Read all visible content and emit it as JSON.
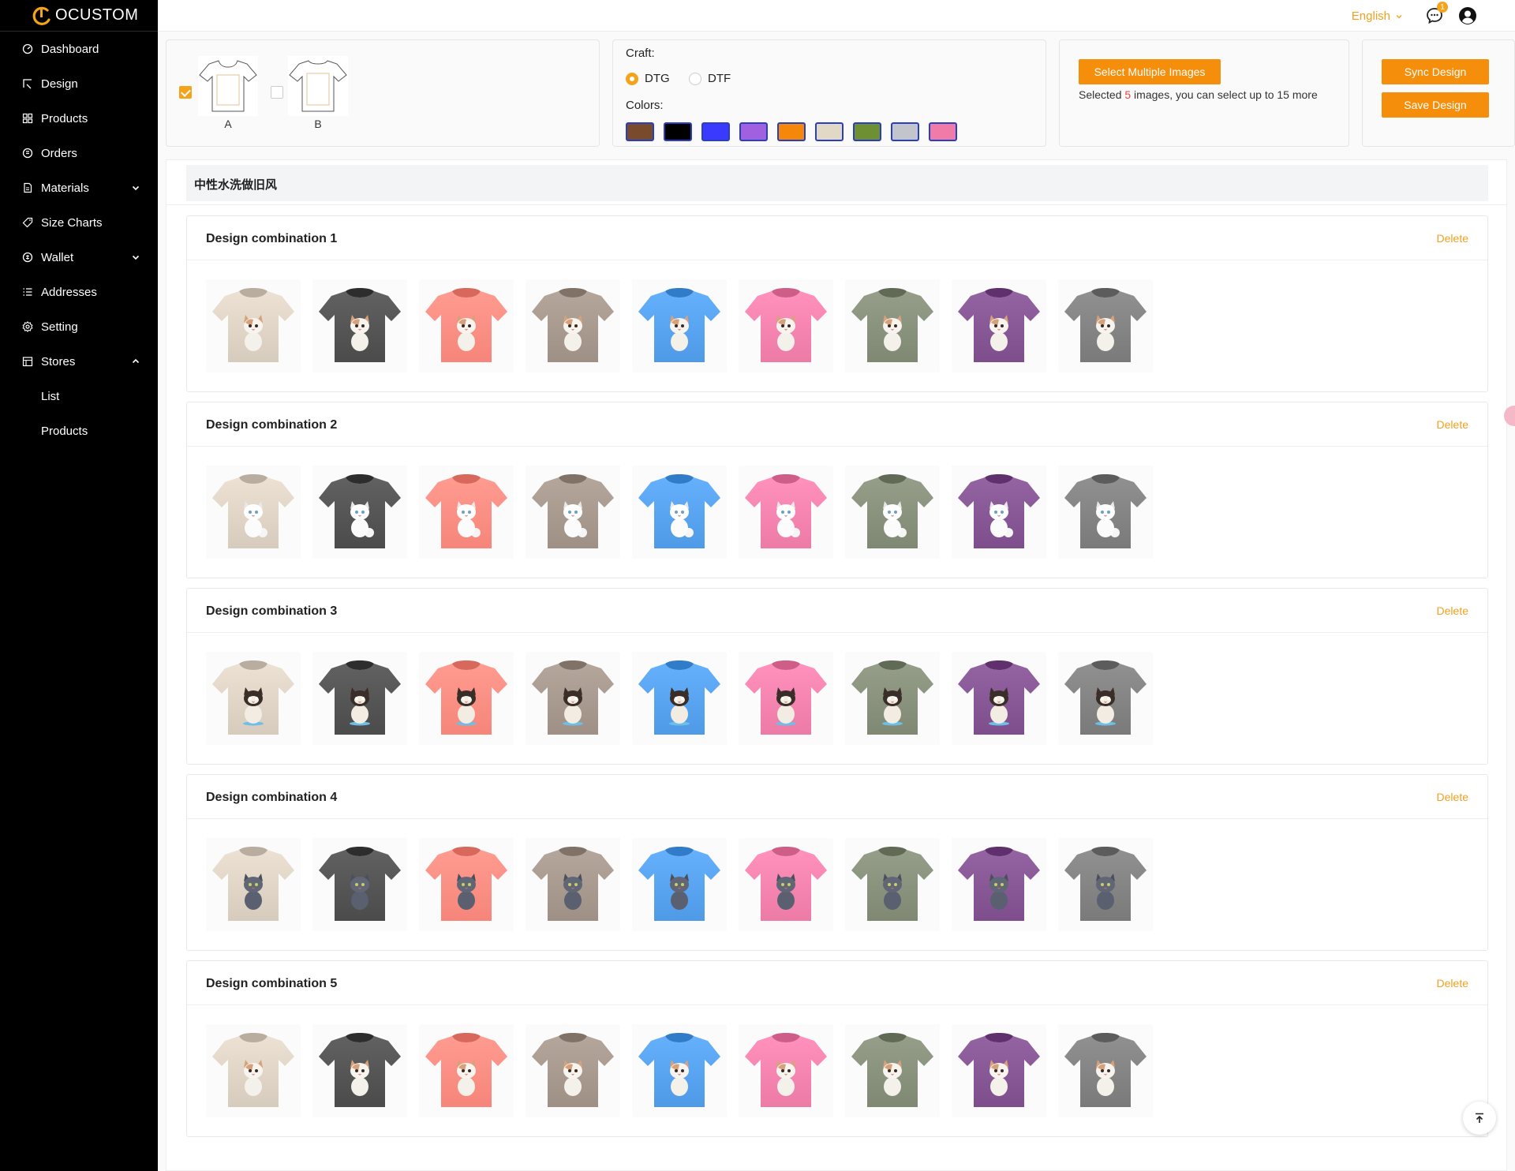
{
  "brand": {
    "name": "OCUSTOM",
    "accent": "#f5a31b"
  },
  "sidebar": {
    "items": [
      {
        "label": "Dashboard",
        "icon": "dashboard-icon"
      },
      {
        "label": "Design",
        "icon": "design-icon"
      },
      {
        "label": "Products",
        "icon": "products-icon"
      },
      {
        "label": "Orders",
        "icon": "orders-icon"
      },
      {
        "label": "Materials",
        "icon": "materials-icon",
        "expandable": true
      },
      {
        "label": "Size Charts",
        "icon": "tag-icon"
      },
      {
        "label": "Wallet",
        "icon": "wallet-icon",
        "expandable": true
      },
      {
        "label": "Addresses",
        "icon": "list-icon"
      },
      {
        "label": "Setting",
        "icon": "gear-icon"
      },
      {
        "label": "Stores",
        "icon": "store-icon",
        "expanded": true
      }
    ],
    "stores_sub": [
      "List",
      "Products"
    ]
  },
  "header": {
    "language": "English",
    "message_count": "1"
  },
  "mockups": [
    {
      "label": "A",
      "checked": true
    },
    {
      "label": "B",
      "checked": false
    }
  ],
  "craft": {
    "label": "Craft:",
    "options": [
      "DTG",
      "DTF"
    ],
    "selected": "DTG",
    "colors_label": "Colors:",
    "colors": [
      "#7a4a2c",
      "#000000",
      "#3a3aff",
      "#a060e0",
      "#f5870a",
      "#e2d8c6",
      "#6f8f33",
      "#c2c6cc",
      "#f07aa8"
    ]
  },
  "selection": {
    "button": "Select Multiple Images",
    "text_before": "Selected ",
    "count": "5",
    "text_after": " images, you can select up to 15 more"
  },
  "actions": {
    "sync": "Sync Design",
    "save": "Save Design"
  },
  "section": {
    "title": "中性水洗做旧风",
    "delete_label": "Delete",
    "shirt_colors": [
      "#d6cbbd",
      "#4b4b4b",
      "#f6857a",
      "#9e9085",
      "#4f9ae6",
      "#ec7ba6",
      "#7f8873",
      "#7e4e8c",
      "#7a7a7a"
    ],
    "combinations": [
      {
        "title": "Design combination 1",
        "cat": "calico"
      },
      {
        "title": "Design combination 2",
        "cat": "white"
      },
      {
        "title": "Design combination 3",
        "cat": "siamese"
      },
      {
        "title": "Design combination 4",
        "cat": "gray"
      },
      {
        "title": "Design combination 5",
        "cat": "calico"
      }
    ]
  }
}
